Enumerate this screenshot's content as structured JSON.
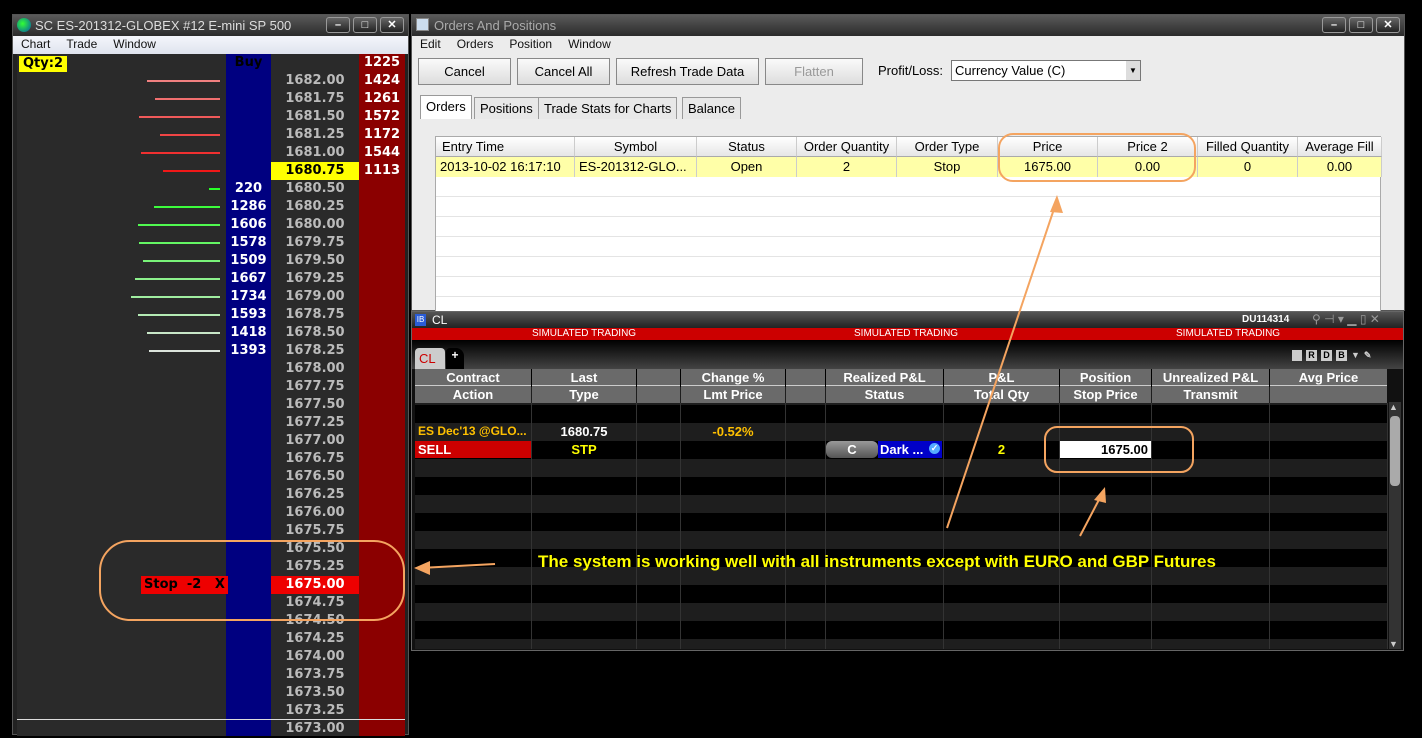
{
  "dom": {
    "title": "SC ES-201312-GLOBEX  #12  E-mini SP 500",
    "menu": [
      "Chart",
      "Trade",
      "Window"
    ],
    "qty_label": "Qty:2",
    "buy_label": "Buy",
    "top_ask": "1225",
    "rows": [
      {
        "price": "1682.00",
        "ask": "1424"
      },
      {
        "price": "1681.75",
        "ask": "1261"
      },
      {
        "price": "1681.50",
        "ask": "1572"
      },
      {
        "price": "1681.25",
        "ask": "1172"
      },
      {
        "price": "1681.00",
        "ask": "1544"
      },
      {
        "price": "1680.75",
        "ask": "1113",
        "last": true
      },
      {
        "price": "1680.50",
        "bid": "220"
      },
      {
        "price": "1680.25",
        "bid": "1286"
      },
      {
        "price": "1680.00",
        "bid": "1606"
      },
      {
        "price": "1679.75",
        "bid": "1578"
      },
      {
        "price": "1679.50",
        "bid": "1509"
      },
      {
        "price": "1679.25",
        "bid": "1667"
      },
      {
        "price": "1679.00",
        "bid": "1734"
      },
      {
        "price": "1678.75",
        "bid": "1593"
      },
      {
        "price": "1678.50",
        "bid": "1418"
      },
      {
        "price": "1678.25",
        "bid": "1393"
      },
      {
        "price": "1678.00"
      },
      {
        "price": "1677.75"
      },
      {
        "price": "1677.50"
      },
      {
        "price": "1677.25"
      },
      {
        "price": "1677.00"
      },
      {
        "price": "1676.75"
      },
      {
        "price": "1676.50"
      },
      {
        "price": "1676.25"
      },
      {
        "price": "1676.00"
      },
      {
        "price": "1675.75"
      },
      {
        "price": "1675.50"
      },
      {
        "price": "1675.25"
      },
      {
        "price": "1675.00",
        "order": "Stop  -2   X"
      },
      {
        "price": "1674.75"
      },
      {
        "price": "1674.50"
      },
      {
        "price": "1674.25"
      },
      {
        "price": "1674.00"
      },
      {
        "price": "1673.75"
      },
      {
        "price": "1673.50"
      },
      {
        "price": "1673.25"
      },
      {
        "price": "1673.00"
      }
    ]
  },
  "orders": {
    "title": "Orders And Positions",
    "menu": [
      "Edit",
      "Orders",
      "Position",
      "Window"
    ],
    "buttons": [
      "Cancel",
      "Cancel All",
      "Refresh Trade Data",
      "Flatten"
    ],
    "pl_label": "Profit/Loss:",
    "pl_value": "Currency Value (C)",
    "tabs": [
      "Orders",
      "Positions",
      "Trade Stats for Charts",
      "Balance"
    ],
    "columns": [
      "Entry Time",
      "Symbol",
      "Status",
      "Order Quantity",
      "Order Type",
      "Price",
      "Price 2",
      "Filled Quantity",
      "Average Fill"
    ],
    "row": [
      "2013-10-02  16:17:10",
      "ES-201312-GLO...",
      "Open",
      "2",
      "Stop",
      "1675.00",
      "0.00",
      "0",
      "0.00"
    ]
  },
  "tws": {
    "title": "CL",
    "account": "DU114314",
    "banner": [
      "SIMULATED TRADING",
      "SIMULATED TRADING",
      "SIMULATED TRADING"
    ],
    "tab": "CL",
    "add_tab": "+",
    "tool_icons": [
      "R",
      "D",
      "B"
    ],
    "headers1": [
      "Contract",
      "Last",
      "",
      "Change %",
      "",
      "Realized P&L",
      "P&L",
      "Position",
      "Unrealized P&L",
      "Avg Price"
    ],
    "headers2": [
      "Action",
      "Type",
      "",
      "Lmt Price",
      "",
      "Status",
      "Total Qty",
      "Stop Price",
      "Transmit",
      ""
    ],
    "contract": "ES Dec'13 @GLO...",
    "last": "1680.75",
    "change": "-0.52%",
    "action": "SELL",
    "type": "STP",
    "status_btn": "C",
    "dest": "Dark ...",
    "total_qty": "2",
    "stop_price": "1675.00"
  },
  "annotation": "The system is working well with all instruments except with EURO and GBP Futures",
  "colors": {
    "orange": "#f4a460",
    "navy": "#000080",
    "darkred": "#8b0000",
    "yellow": "#ffff00"
  }
}
